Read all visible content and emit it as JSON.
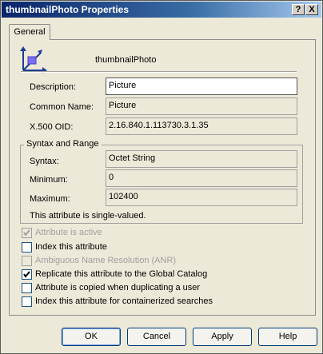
{
  "window": {
    "title": "thumbnailPhoto Properties",
    "help_button": "?",
    "close_button": "X"
  },
  "tabs": [
    {
      "label": "General"
    }
  ],
  "header": {
    "name": "thumbnailPhoto",
    "icon": "attribute-icon"
  },
  "fields": {
    "description": {
      "label": "Description:",
      "value": "Picture"
    },
    "common_name": {
      "label": "Common Name:",
      "value": "Picture"
    },
    "oid": {
      "label": "X.500 OID:",
      "value": "2.16.840.1.113730.3.1.35"
    }
  },
  "syntax_group": {
    "title": "Syntax and Range",
    "syntax": {
      "label": "Syntax:",
      "value": "Octet String"
    },
    "minimum": {
      "label": "Minimum:",
      "value": "0"
    },
    "maximum": {
      "label": "Maximum:",
      "value": "102400"
    },
    "note": "This attribute is single-valued."
  },
  "checkboxes": [
    {
      "label": "Attribute is active",
      "checked": true,
      "disabled": true
    },
    {
      "label": "Index this attribute",
      "checked": false,
      "disabled": false
    },
    {
      "label": "Ambiguous Name Resolution (ANR)",
      "checked": false,
      "disabled": true
    },
    {
      "label": "Replicate this attribute to the Global Catalog",
      "checked": true,
      "disabled": false
    },
    {
      "label": "Attribute is copied when duplicating a user",
      "checked": false,
      "disabled": false
    },
    {
      "label": "Index this attribute for containerized searches",
      "checked": false,
      "disabled": false
    }
  ],
  "buttons": {
    "ok": "OK",
    "cancel": "Cancel",
    "apply": "Apply",
    "help": "Help"
  }
}
